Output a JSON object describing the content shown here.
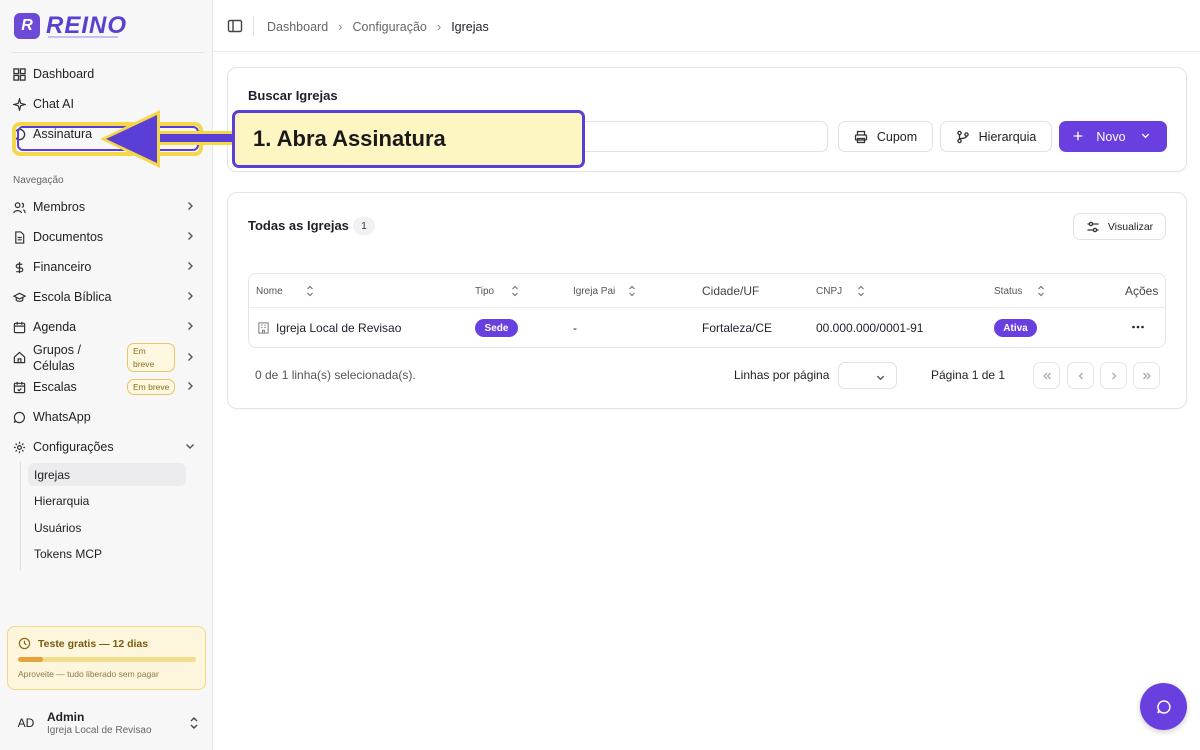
{
  "app": {
    "logo_text": "REINO",
    "logo_mark": "R"
  },
  "sidebar": {
    "top_items": [
      {
        "label": "Dashboard",
        "icon": "dashboard-icon"
      },
      {
        "label": "Chat AI",
        "icon": "sparkles-icon"
      },
      {
        "label": "Assinatura",
        "icon": "circle-icon"
      }
    ],
    "section_label": "Navegação",
    "nav_items": [
      {
        "label": "Membros",
        "icon": "users-icon"
      },
      {
        "label": "Documentos",
        "icon": "document-icon"
      },
      {
        "label": "Financeiro",
        "icon": "dollar-icon"
      },
      {
        "label": "Escola Bíblica",
        "icon": "graduation-cap-icon"
      },
      {
        "label": "Agenda",
        "icon": "calendar-icon"
      },
      {
        "label": "Grupos /",
        "label2": "Células",
        "icon": "home-icon",
        "badge": "Em",
        "badge2": "breve"
      },
      {
        "label": "Escalas",
        "icon": "calendar-check-icon",
        "badge": "Em breve"
      },
      {
        "label": "WhatsApp",
        "icon": "message-circle-icon"
      },
      {
        "label": "Configurações",
        "icon": "gear-icon"
      }
    ],
    "sub_items": [
      "Igrejas",
      "Hierarquia",
      "Usuários",
      "Tokens MCP"
    ],
    "active_sub": "Igrejas",
    "trial": {
      "title": "Teste gratis — 12 dias",
      "note": "Aproveite — tudo liberado sem pagar",
      "progress": 0.14
    },
    "user": {
      "initials": "AD",
      "name": "Admin",
      "org": "Igreja Local de Revisao"
    }
  },
  "topbar": {
    "breadcrumbs": [
      "Dashboard",
      "Configuração",
      "Igrejas"
    ]
  },
  "search_card": {
    "title": "Buscar Igrejas",
    "buttons": {
      "cupom": "Cupom",
      "hierarquia": "Hierarquia",
      "novo": "Novo"
    }
  },
  "list_card": {
    "title": "Todas as Igrejas",
    "count": "1",
    "view_button": "Visualizar",
    "columns": [
      "Nome",
      "Tipo",
      "Igreja Pai",
      "Cidade/UF",
      "CNPJ",
      "Status",
      "Ações"
    ],
    "rows": [
      {
        "nome": "Igreja Local de Revisao",
        "tipo": "Sede",
        "igreja_pai": "-",
        "cidade": "Fortaleza/CE",
        "cnpj": "00.000.000/0001-91",
        "status": "Ativa"
      }
    ],
    "footer": {
      "selected": "0 de 1 linha(s) selecionada(s).",
      "rows_per_page": "Linhas por página",
      "page_info": "Página 1 de 1"
    }
  },
  "annotation": {
    "callout": "1. Abra Assinatura"
  },
  "colors": {
    "accent": "#6a3fe0",
    "highlight": "#f4d84a",
    "callout_bg": "#fdf6c3"
  }
}
